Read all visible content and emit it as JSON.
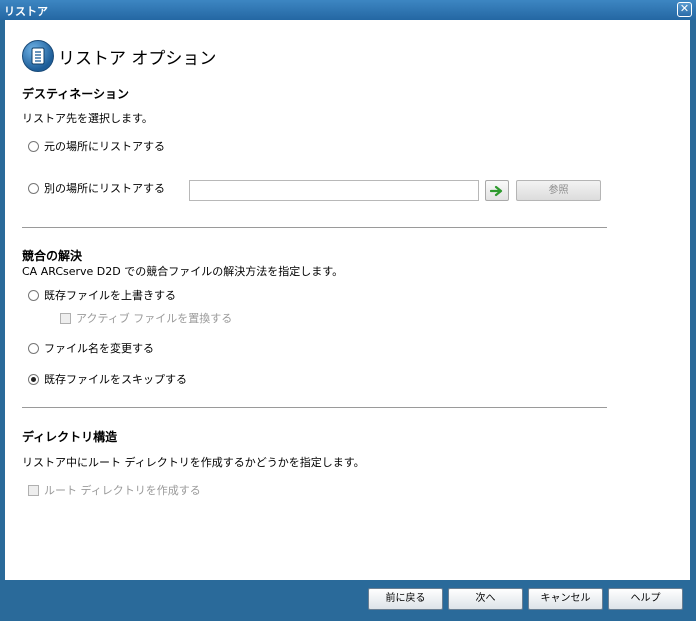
{
  "window": {
    "title": "リストア"
  },
  "header": {
    "title": "リストア オプション"
  },
  "destination": {
    "title": "デスティネーション",
    "description": "リストア先を選択します。",
    "option_original": "元の場所にリストアする",
    "option_alternate": "別の場所にリストアする",
    "path_value": "",
    "browse_label": "参照",
    "selected": "original"
  },
  "conflict": {
    "title": "競合の解決",
    "description": "CA ARCserve D2D での競合ファイルの解決方法を指定します。",
    "option_overwrite": "既存ファイルを上書きする",
    "replace_active_label": "アクティブ ファイルを置換する",
    "option_rename": "ファイル名を変更する",
    "option_skip": "既存ファイルをスキップする",
    "selected": "skip"
  },
  "directory": {
    "title": "ディレクトリ構造",
    "description": "リストア中にルート ディレクトリを作成するかどうかを指定します。",
    "create_root_label": "ルート ディレクトリを作成する"
  },
  "footer": {
    "back_label": "前に戻る",
    "next_label": "次へ",
    "cancel_label": "キャンセル",
    "help_label": "ヘルプ"
  },
  "colors": {
    "frame": "#2a6a9a",
    "titlebar": "#2467a3",
    "accent_arrow": "#2e9a2e"
  }
}
